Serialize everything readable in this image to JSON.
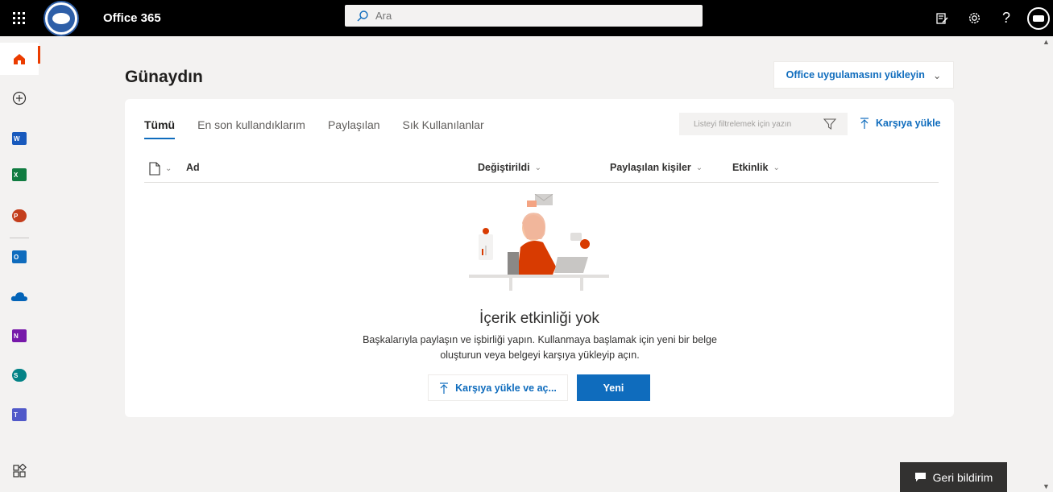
{
  "topbar": {
    "app_title": "Office 365",
    "search_placeholder": "Ara"
  },
  "main": {
    "greeting": "Günaydın",
    "install_button_label": "Office uygulamasını yükleyin",
    "tabs": [
      {
        "label": "Tümü",
        "active": true
      },
      {
        "label": "En son kullandıklarım",
        "active": false
      },
      {
        "label": "Paylaşılan",
        "active": false
      },
      {
        "label": "Sık Kullanılanlar",
        "active": false
      }
    ],
    "filter_placeholder": "Listeyi filtrelemek için yazın",
    "upload_label": "Karşıya yükle",
    "columns": {
      "name": "Ad",
      "modified": "Değiştirildi",
      "shared_with": "Paylaşılan kişiler",
      "activity": "Etkinlik"
    },
    "empty_state": {
      "title": "İçerik etkinliği yok",
      "description": "Başkalarıyla paylaşın ve işbirliği yapın. Kullanmaya başlamak için yeni bir belge oluşturun veya belgeyi karşıya yükleyip açın.",
      "upload_open_label": "Karşıya yükle ve aç...",
      "new_label": "Yeni"
    }
  },
  "rail": {
    "apps": [
      {
        "name": "home",
        "color": "#eb3c00"
      },
      {
        "name": "word",
        "letter": "W",
        "color": "#185abd"
      },
      {
        "name": "excel",
        "letter": "X",
        "color": "#107c41"
      },
      {
        "name": "powerpoint",
        "letter": "P",
        "color": "#c43e1c"
      },
      {
        "name": "outlook",
        "letter": "O",
        "color": "#0f6cbd"
      },
      {
        "name": "onedrive",
        "color": "#0364b8"
      },
      {
        "name": "onenote",
        "letter": "N",
        "color": "#7719aa"
      },
      {
        "name": "sharepoint",
        "letter": "S",
        "color": "#038387"
      },
      {
        "name": "teams",
        "letter": "T",
        "color": "#5059c9"
      }
    ]
  },
  "feedback_label": "Geri bildirim",
  "colors": {
    "accent": "#0f6cbd",
    "home_accent": "#eb3c00",
    "topbar": "#000000"
  }
}
